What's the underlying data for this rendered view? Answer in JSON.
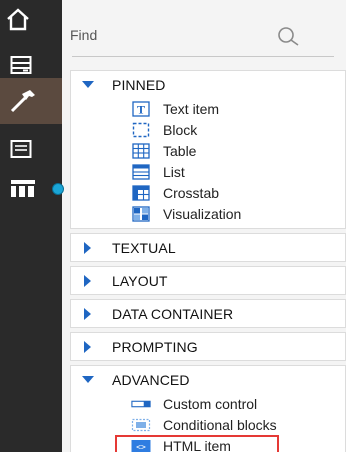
{
  "rail": {
    "home": "home-icon",
    "data": "data-icon",
    "toolbox": "toolbox-icon",
    "pages": "pages-icon",
    "queries": "queries-icon"
  },
  "search": {
    "placeholder": "Find"
  },
  "groups": [
    {
      "label": "PINNED",
      "expanded": true,
      "items": [
        {
          "label": "Text item",
          "icon": "text-item-icon"
        },
        {
          "label": "Block",
          "icon": "block-icon"
        },
        {
          "label": "Table",
          "icon": "table-icon"
        },
        {
          "label": "List",
          "icon": "list-icon"
        },
        {
          "label": "Crosstab",
          "icon": "crosstab-icon"
        },
        {
          "label": "Visualization",
          "icon": "visualization-icon"
        }
      ]
    },
    {
      "label": "TEXTUAL",
      "expanded": false
    },
    {
      "label": "LAYOUT",
      "expanded": false
    },
    {
      "label": "DATA CONTAINER",
      "expanded": false
    },
    {
      "label": "PROMPTING",
      "expanded": false
    },
    {
      "label": "ADVANCED",
      "expanded": true,
      "items": [
        {
          "label": "Custom control",
          "icon": "custom-control-icon"
        },
        {
          "label": "Conditional blocks",
          "icon": "conditional-blocks-icon"
        },
        {
          "label": "HTML item",
          "icon": "html-item-icon",
          "highlighted": true
        }
      ]
    }
  ],
  "colors": {
    "accent": "#1f66c2",
    "rail_bg": "#2a2a2a",
    "rail_active": "#5b4a3f",
    "highlight_frame": "#e53935"
  }
}
